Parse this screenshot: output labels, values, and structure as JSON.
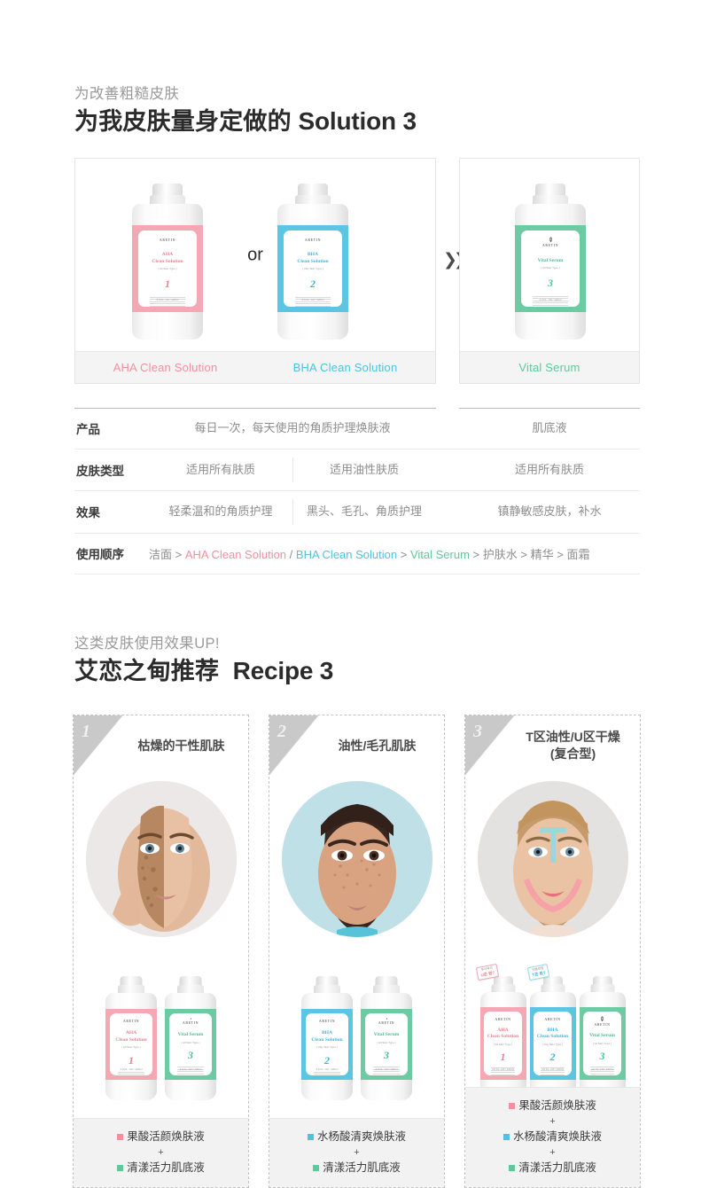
{
  "solution_section": {
    "eyebrow": "为改善粗糙皮肤",
    "headline_cn": "为我皮肤量身定做的",
    "headline_en": "Solution 3",
    "or_label": "or",
    "arrow_icon": "❯❯❯",
    "captions": {
      "aha": "AHA Clean Solution",
      "bha": "BHA Clean Solution",
      "vital": "Vital Serum"
    },
    "bottles": {
      "aha": {
        "brand": "ARETIN",
        "name": "AHA\nClean Solution",
        "sub": "( All Skin Type )",
        "number": "1",
        "volume": "4.0 FL. OZ / 120ml",
        "color": "#f4a8b4"
      },
      "bha": {
        "brand": "ARETIN",
        "name": "BHA\nClean Solution",
        "sub": "( Oily Skin Type )",
        "number": "2",
        "volume": "4.0 FL. OZ / 120ml",
        "color": "#5cc6e2"
      },
      "vital": {
        "brand": "ARETIN",
        "name": "Vital Serum",
        "sub": "( All Skin Type )",
        "number": "3",
        "volume": "4.0 FL. OZ / 120ml",
        "color": "#6ccba2"
      }
    }
  },
  "table": {
    "rows": [
      {
        "label": "产品",
        "span": "每日一次，每天使用的角质护理焕肤液",
        "c": "肌底液"
      },
      {
        "label": "皮肤类型",
        "a": "适用所有肤质",
        "b": "适用油性肤质",
        "c": "适用所有肤质"
      },
      {
        "label": "效果",
        "a": "轻柔温和的角质护理",
        "b": "黑头、毛孔、角质护理",
        "c": "镇静敏感皮肤，补水"
      }
    ],
    "order": {
      "label": "使用顺序",
      "step1": "洁面",
      "sep1": ">",
      "aha": "AHA Clean Solution",
      "slash": "/",
      "bha": "BHA Clean Solution",
      "sep2": ">",
      "vital": "Vital Serum",
      "sep3": ">",
      "step5": "护肤水",
      "sep4": ">",
      "step6": "精华",
      "sep5": ">",
      "step7": "面霜"
    }
  },
  "recipe_section": {
    "eyebrow": "这类皮肤使用效果UP!",
    "headline_cn": "艾恋之甸推荐",
    "headline_en": "Recipe 3",
    "cards": [
      {
        "number": "1",
        "title": "枯燥的干性肌肤",
        "photo_name": "dry-skin-before-after-photo",
        "bottles": [
          "aha",
          "vital"
        ],
        "products": [
          {
            "name": "果酸活颜焕肤液",
            "color": "pink"
          },
          {
            "name": "清漾活力肌底液",
            "color": "green"
          }
        ],
        "plus": "+"
      },
      {
        "number": "2",
        "title": "油性/毛孔肌肤",
        "photo_name": "oily-pore-skin-photo",
        "bottles": [
          "bha",
          "vital"
        ],
        "products": [
          {
            "name": "水杨酸清爽焕肤液",
            "color": "blue"
          },
          {
            "name": "清漾活力肌底液",
            "color": "green"
          }
        ],
        "plus": "+"
      },
      {
        "number": "3",
        "title": "T区油性/U区干燥\n(复合型)",
        "photo_name": "combination-skin-tzone-photo",
        "bottles": [
          "aha",
          "bha",
          "vital"
        ],
        "products": [
          {
            "name": "果酸活颜焕肤液",
            "color": "pink"
          },
          {
            "name": "水杨酸清爽焕肤液",
            "color": "blue"
          },
          {
            "name": "清漾活力肌底液",
            "color": "green"
          }
        ],
        "plus": "+",
        "stickers": [
          {
            "top": "푸석푸석",
            "bottom": "U존 뭔?"
          },
          {
            "top": "번들번들",
            "bottom": "T존 뭔?"
          }
        ]
      }
    ]
  },
  "colors": {
    "pink": "#f4909e",
    "blue": "#4ec3e0",
    "green": "#5ec99a",
    "heading": "#2b2b2b",
    "eyebrow": "#9a9a9a",
    "body": "#8d8d8d"
  }
}
